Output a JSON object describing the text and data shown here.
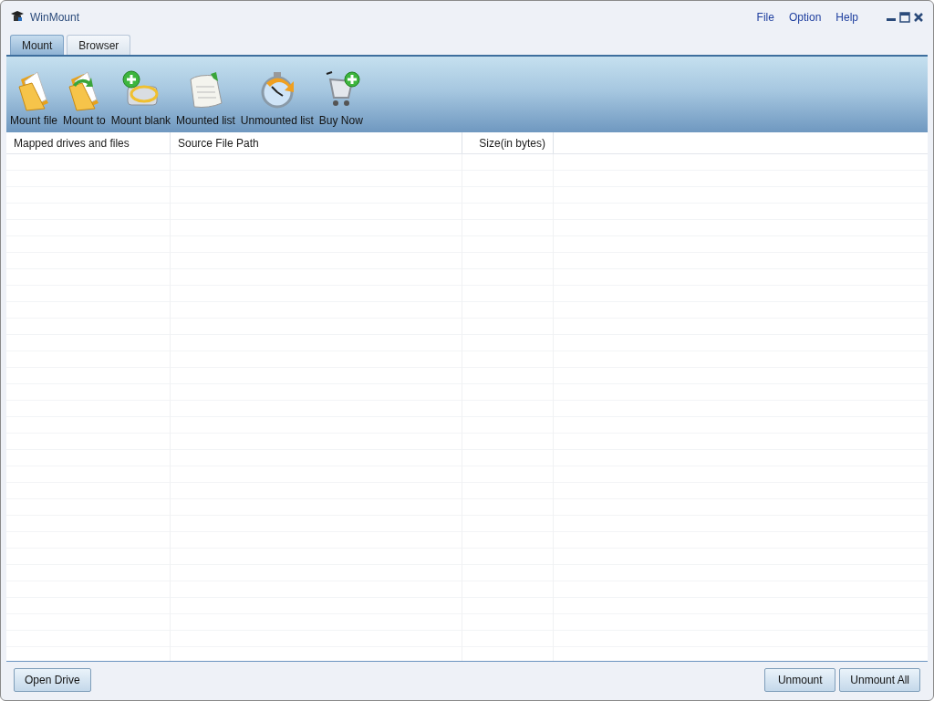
{
  "window": {
    "title": "WinMount"
  },
  "menu": [
    "File",
    "Option",
    "Help"
  ],
  "tabs": [
    {
      "label": "Mount",
      "selected": true
    },
    {
      "label": "Browser",
      "selected": false
    }
  ],
  "toolbar": [
    {
      "label": "Mount file",
      "kind": "folder"
    },
    {
      "label": "Mount to",
      "kind": "folder-arrow"
    },
    {
      "label": "Mount blank",
      "kind": "drive-plus"
    },
    {
      "label": "Mounted list",
      "kind": "document"
    },
    {
      "label": "Unmounted list",
      "kind": "clock"
    },
    {
      "label": "Buy Now",
      "kind": "cart"
    }
  ],
  "table": {
    "columns": [
      {
        "label": "Mapped drives and files",
        "kind": "text"
      },
      {
        "label": "Source File Path",
        "kind": "text"
      },
      {
        "label": "Size(in bytes)",
        "kind": "number"
      }
    ]
  },
  "footer": {
    "left_buttons": [
      "Open Drive"
    ],
    "right_buttons": [
      "Unmount",
      "Unmount All"
    ]
  }
}
